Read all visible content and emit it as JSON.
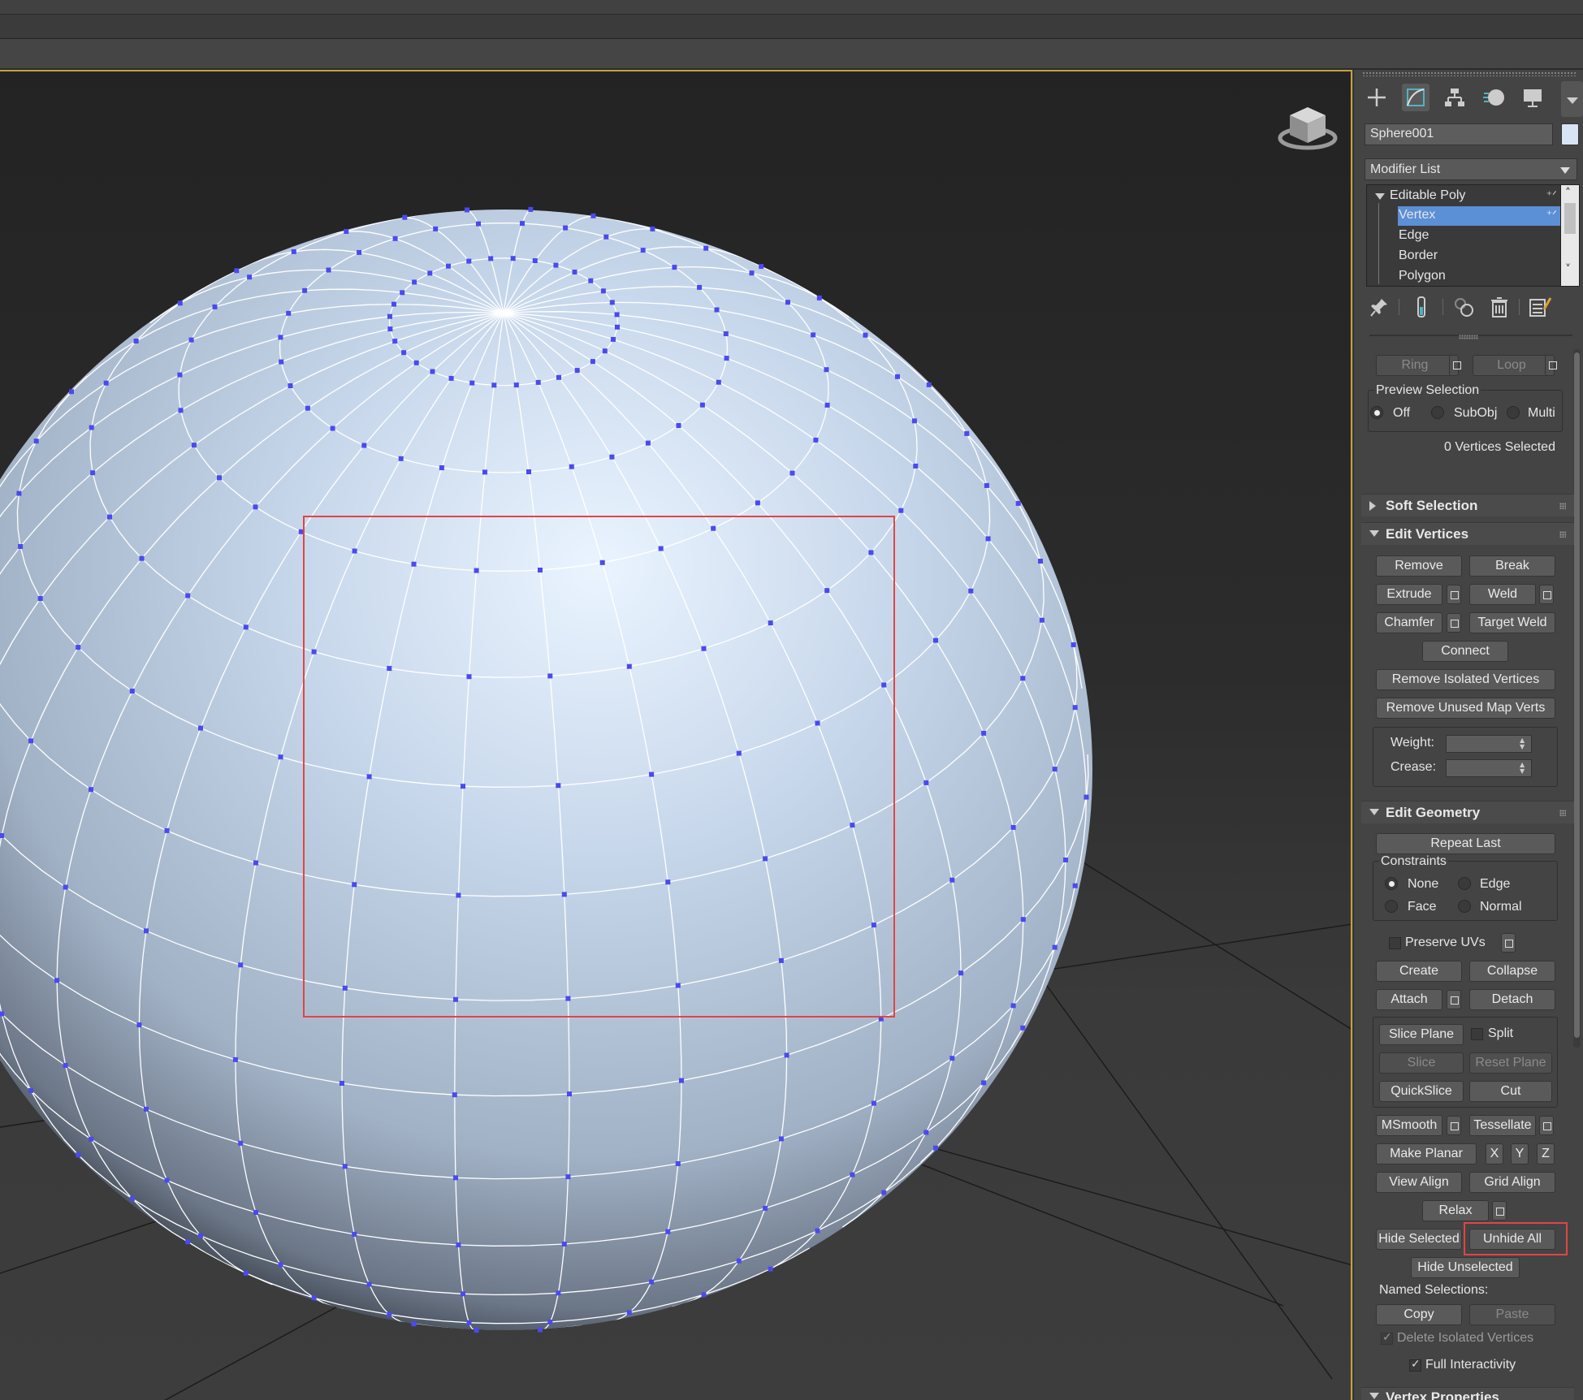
{
  "colors": {
    "viewport_border": "#c8a23a",
    "selection_rect": "#e04545",
    "vertex": "#4a4af0",
    "stack_selected": "#5b8fd6"
  },
  "viewport": {
    "object": "sphere-wireframe",
    "viewcube": "viewcube-icon"
  },
  "command_panel": {
    "tabs": [
      "create-icon",
      "modify-icon",
      "hierarchy-icon",
      "motion-icon",
      "display-icon"
    ],
    "object_name": "Sphere001",
    "object_color": "#d6e4f5",
    "modifier_list_label": "Modifier List",
    "stack": {
      "root": "Editable Poly",
      "items": [
        "Vertex",
        "Edge",
        "Border",
        "Polygon"
      ],
      "selected": "Vertex"
    },
    "stack_tools": [
      "pin-stack-icon",
      "show-end-result-icon",
      "make-unique-icon",
      "remove-modifier-icon",
      "configure-modifier-sets-icon"
    ]
  },
  "selection": {
    "ring": "Ring",
    "loop": "Loop",
    "preview_label": "Preview Selection",
    "preview_off": "Off",
    "preview_subobj": "SubObj",
    "preview_multi": "Multi",
    "status": "0 Vertices Selected"
  },
  "soft_selection": {
    "title": "Soft Selection"
  },
  "edit_vertices": {
    "title": "Edit Vertices",
    "remove": "Remove",
    "break": "Break",
    "extrude": "Extrude",
    "weld": "Weld",
    "chamfer": "Chamfer",
    "target_weld": "Target Weld",
    "connect": "Connect",
    "remove_isolated": "Remove Isolated Vertices",
    "remove_unused_map": "Remove Unused Map Verts",
    "weight_label": "Weight:",
    "crease_label": "Crease:"
  },
  "edit_geometry": {
    "title": "Edit Geometry",
    "repeat_last": "Repeat Last",
    "constraints_label": "Constraints",
    "c_none": "None",
    "c_edge": "Edge",
    "c_face": "Face",
    "c_normal": "Normal",
    "preserve_uvs": "Preserve UVs",
    "create": "Create",
    "collapse": "Collapse",
    "attach": "Attach",
    "detach": "Detach",
    "slice_plane": "Slice Plane",
    "split": "Split",
    "slice": "Slice",
    "reset_plane": "Reset Plane",
    "quickslice": "QuickSlice",
    "cut": "Cut",
    "msmooth": "MSmooth",
    "tessellate": "Tessellate",
    "make_planar": "Make Planar",
    "x": "X",
    "y": "Y",
    "z": "Z",
    "view_align": "View Align",
    "grid_align": "Grid Align",
    "relax": "Relax",
    "hide_selected": "Hide Selected",
    "unhide_all": "Unhide All",
    "hide_unselected": "Hide Unselected",
    "named_selections": "Named Selections:",
    "copy": "Copy",
    "paste": "Paste",
    "delete_isolated": "Delete Isolated Vertices",
    "full_interactivity": "Full Interactivity"
  },
  "vertex_properties": {
    "title": "Vertex Properties"
  }
}
